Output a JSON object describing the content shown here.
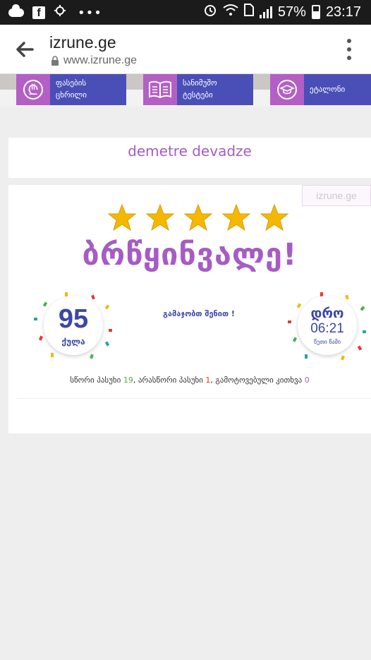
{
  "status_bar": {
    "battery": "57%",
    "time": "23:17",
    "icons": [
      "cloud-icon",
      "facebook-icon",
      "weather-icon",
      "more-icon",
      "alarm-icon",
      "wifi-icon",
      "sim-icon",
      "signal-icon",
      "battery-icon"
    ]
  },
  "browser": {
    "title": "izrune.ge",
    "url": "www.izrune.ge"
  },
  "nav": [
    {
      "icon": "lari-icon",
      "line1": "ფასების",
      "line2": "ცხრილი"
    },
    {
      "icon": "book-icon",
      "line1": "სანიმუშო",
      "line2": "ტესტები"
    },
    {
      "icon": "cap-icon",
      "line1": "ეტალონი",
      "line2": ""
    }
  ],
  "user": {
    "name": "demetre devadze"
  },
  "result": {
    "watermark": "izrune.ge",
    "stars": 5,
    "headline": "ბრწყინვალე!",
    "score_value": "95",
    "score_unit": "ქულა",
    "congrats": "გამაჯობთ შენით !",
    "time_label": "დრო",
    "time_value": "06:21",
    "time_unit": "წუთი წამი",
    "summary_correct_label": "სწორი პასუხი",
    "summary_correct": "19",
    "summary_wrong_label": ", არასწორი პასუხი",
    "summary_wrong": "1",
    "summary_skipped_label": ", გამოტოვებული კითხვა",
    "summary_skipped": "0"
  },
  "colors": {
    "accent_purple": "#a65cc4",
    "nav_blue": "#4a4fb8",
    "star": "#f5b800",
    "correct": "#4caf50",
    "wrong": "#e53935"
  }
}
